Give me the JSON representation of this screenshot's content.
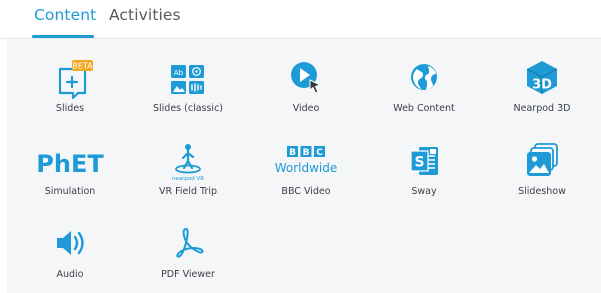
{
  "tabs": [
    {
      "label": "Content"
    },
    {
      "label": "Activities"
    }
  ],
  "active_tab": "Content",
  "accent_color": "#1e9bd7",
  "tiles": [
    {
      "label": "Slides",
      "icon": "slides-icon",
      "badge": "BETA"
    },
    {
      "label": "Slides (classic)",
      "icon": "slides-classic-icon",
      "icon_text": "Ab"
    },
    {
      "label": "Video",
      "icon": "video-icon"
    },
    {
      "label": "Web Content",
      "icon": "web-content-icon"
    },
    {
      "label": "Nearpod 3D",
      "icon": "nearpod-3d-icon",
      "icon_text": "3D"
    },
    {
      "label": "Simulation",
      "icon": "phet-icon",
      "icon_text": "PhET"
    },
    {
      "label": "VR Field Trip",
      "icon": "vr-field-trip-icon",
      "icon_text": "nearpod VR"
    },
    {
      "label": "BBC Video",
      "icon": "bbc-icon",
      "icon_text_letters": [
        "B",
        "B",
        "C"
      ],
      "icon_text": "Worldwide"
    },
    {
      "label": "Sway",
      "icon": "sway-icon",
      "icon_text": "S"
    },
    {
      "label": "Slideshow",
      "icon": "slideshow-icon"
    },
    {
      "label": "Audio",
      "icon": "audio-icon"
    },
    {
      "label": "PDF Viewer",
      "icon": "pdf-viewer-icon"
    }
  ]
}
